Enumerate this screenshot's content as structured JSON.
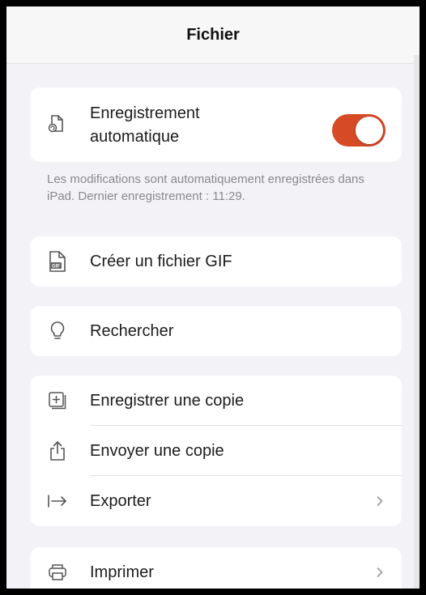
{
  "header": {
    "title": "Fichier"
  },
  "autosave": {
    "label": "Enregistrement automatique",
    "icon": "document-autosave-icon",
    "enabled": true,
    "toggle_color": "#d64a26",
    "note": "Les modifications sont automatiquement enregistrées dans iPad. Dernier enregistrement : 11:29."
  },
  "gif": {
    "label": "Créer un fichier GIF",
    "icon": "gif-document-icon"
  },
  "search": {
    "label": "Rechercher",
    "icon": "lightbulb-icon"
  },
  "copy_group": {
    "items": [
      {
        "label": "Enregistrer une copie",
        "icon": "plus-square-icon"
      },
      {
        "label": "Envoyer une copie",
        "icon": "share-icon"
      },
      {
        "label": "Exporter",
        "icon": "export-arrow-icon"
      }
    ]
  },
  "print": {
    "label": "Imprimer",
    "icon": "printer-icon"
  }
}
